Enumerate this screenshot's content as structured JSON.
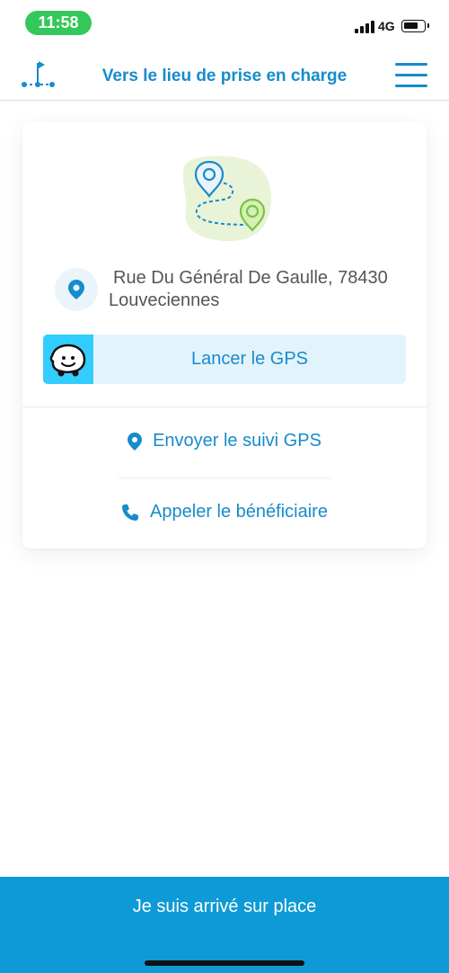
{
  "status_bar": {
    "time": "11:58",
    "network": "4G"
  },
  "header": {
    "title": "Vers le lieu de prise en charge",
    "accent_color": "#168ccc"
  },
  "destination": {
    "address_line1": "Rue Du Général De Gaulle, 78430",
    "address_line2": "Louveciennes"
  },
  "gps": {
    "launch_label": "Lancer le GPS",
    "app_icon": "waze-icon",
    "app_color": "#33ccff"
  },
  "actions": {
    "send_tracking_label": "Envoyer le suivi GPS",
    "call_beneficiary_label": "Appeler le bénéficiaire"
  },
  "footer": {
    "arrived_label": "Je suis arrivé sur place",
    "button_color": "#0e9ad6"
  },
  "icons": {
    "route": "route-flag-icon",
    "menu": "hamburger-menu-icon",
    "location": "location-pin-icon",
    "phone": "phone-icon"
  }
}
